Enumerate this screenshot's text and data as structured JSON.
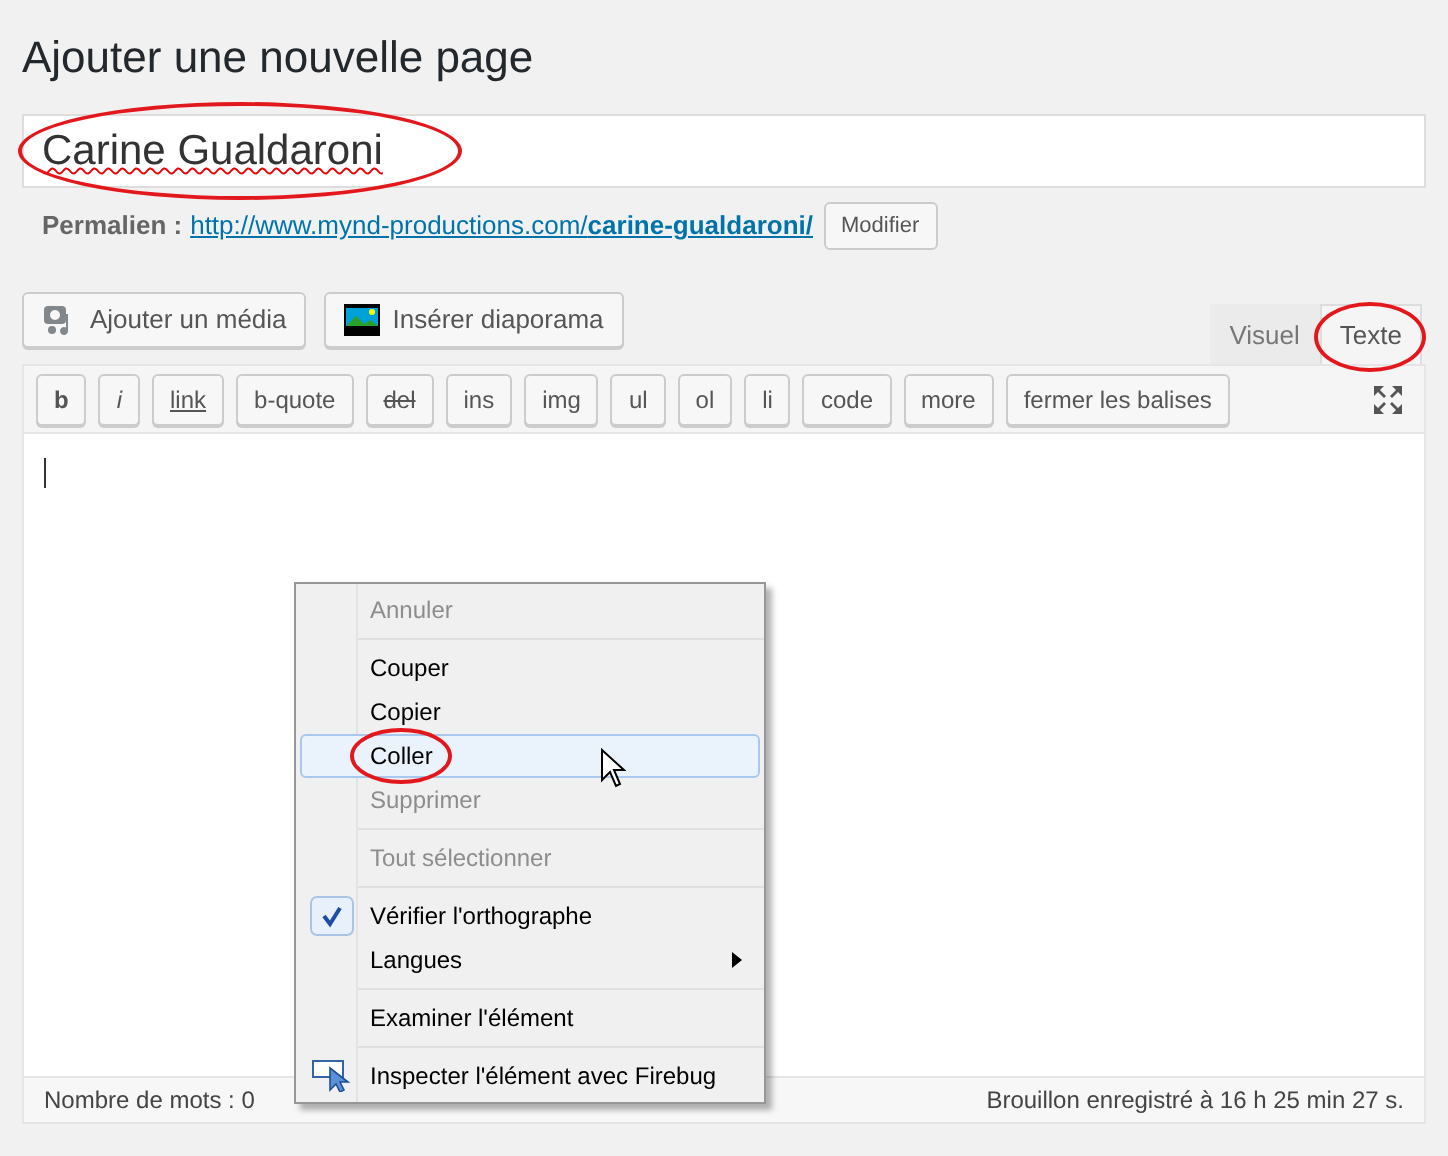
{
  "heading": "Ajouter une nouvelle page",
  "title_field": {
    "value": "Carine Gualdaroni",
    "circled": true
  },
  "permalink": {
    "label": "Permalien :",
    "url_base": "http://www.mynd-productions.com/",
    "slug": "carine-gualdaroni/",
    "button": "Modifier"
  },
  "media_buttons": [
    {
      "kind": "media",
      "label": "Ajouter un média"
    },
    {
      "kind": "slideshow",
      "label": "Insérer diaporama"
    }
  ],
  "editor_tabs": [
    {
      "label": "Visuel",
      "selected": false,
      "circled": false
    },
    {
      "label": "Texte",
      "selected": true,
      "circled": true
    }
  ],
  "quicktags": [
    {
      "label": "b",
      "kind": "bold"
    },
    {
      "label": "i",
      "kind": "italic"
    },
    {
      "label": "link",
      "kind": "link"
    },
    {
      "label": "b-quote",
      "kind": "plain"
    },
    {
      "label": "del",
      "kind": "deleted"
    },
    {
      "label": "ins",
      "kind": "plain"
    },
    {
      "label": "img",
      "kind": "plain"
    },
    {
      "label": "ul",
      "kind": "plain"
    },
    {
      "label": "ol",
      "kind": "plain"
    },
    {
      "label": "li",
      "kind": "plain"
    },
    {
      "label": "code",
      "kind": "plain"
    },
    {
      "label": "more",
      "kind": "plain"
    },
    {
      "label": "fermer les balises",
      "kind": "plain"
    }
  ],
  "context_menu": {
    "groups": [
      [
        {
          "kind": "plain",
          "label": "Annuler",
          "disabled": true,
          "highlighted": false,
          "checked": false,
          "submenu": false,
          "circled": false
        }
      ],
      [
        {
          "kind": "plain",
          "label": "Couper",
          "disabled": false,
          "highlighted": false,
          "checked": false,
          "submenu": false,
          "circled": false
        },
        {
          "kind": "plain",
          "label": "Copier",
          "disabled": false,
          "highlighted": false,
          "checked": false,
          "submenu": false,
          "circled": false
        },
        {
          "kind": "plain",
          "label": "Coller",
          "disabled": false,
          "highlighted": true,
          "checked": false,
          "submenu": false,
          "circled": true
        },
        {
          "kind": "plain",
          "label": "Supprimer",
          "disabled": true,
          "highlighted": false,
          "checked": false,
          "submenu": false,
          "circled": false
        }
      ],
      [
        {
          "kind": "plain",
          "label": "Tout sélectionner",
          "disabled": true,
          "highlighted": false,
          "checked": false,
          "submenu": false,
          "circled": false
        }
      ],
      [
        {
          "kind": "plain",
          "label": "Vérifier l'orthographe",
          "disabled": false,
          "highlighted": false,
          "checked": true,
          "submenu": false,
          "circled": false
        },
        {
          "kind": "plain",
          "label": "Langues",
          "disabled": false,
          "highlighted": false,
          "checked": false,
          "submenu": true,
          "circled": false
        }
      ],
      [
        {
          "kind": "plain",
          "label": "Examiner l'élément",
          "disabled": false,
          "highlighted": false,
          "checked": false,
          "submenu": false,
          "circled": false
        }
      ],
      [
        {
          "label": "Inspecter l'élément avec Firebug",
          "disabled": false,
          "highlighted": false,
          "checked": false,
          "submenu": false,
          "circled": false,
          "kind": "inspect"
        }
      ]
    ]
  },
  "status_bar": {
    "word_count": "Nombre de mots : 0",
    "draft_saved": "Brouillon enregistré à 16 h 25 min 27 s."
  }
}
